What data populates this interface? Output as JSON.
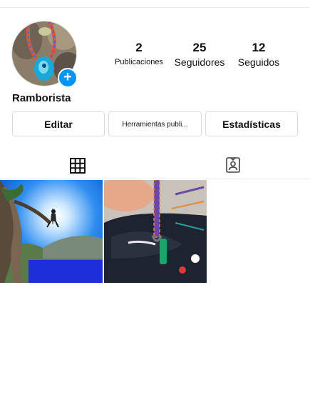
{
  "profile": {
    "username": "Ramborista",
    "add_badge": "+",
    "stats": [
      {
        "value": "2",
        "label": "Publicaciones"
      },
      {
        "value": "25",
        "label": "Seguidores"
      },
      {
        "value": "12",
        "label": "Seguidos"
      }
    ]
  },
  "buttons": {
    "edit": "Editar",
    "tools": "Herramientas publi...",
    "stats": "Estadísticas"
  },
  "tabs": [
    {
      "icon": "grid-icon",
      "active": true
    },
    {
      "icon": "tagged-person-icon",
      "active": false
    }
  ],
  "posts": [
    {
      "subject": "climber-rappelling-tree"
    },
    {
      "subject": "beaded-keychain-cap"
    }
  ],
  "colors": {
    "accent": "#0095f6",
    "border": "#dbdbdb",
    "text": "#111111"
  }
}
